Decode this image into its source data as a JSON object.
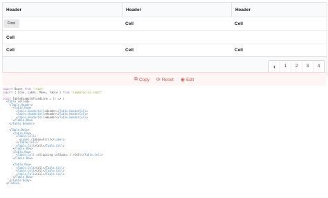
{
  "table": {
    "headers": [
      "Header",
      "Header",
      "Header"
    ],
    "ribbon_label": "First",
    "rows": [
      [
        "Cell",
        "Cell"
      ],
      [
        "Cell"
      ],
      [
        "Cell",
        "Cell",
        "Cell"
      ]
    ],
    "pagination": {
      "prev_icon": "chevron-left-icon",
      "pages": [
        "1",
        "2",
        "3",
        "4"
      ]
    }
  },
  "toolbar": {
    "copy_label": "Copy",
    "reset_label": "Reset",
    "edit_label": "Edit",
    "copy_icon": "copy-icon",
    "reset_icon": "refresh-icon",
    "edit_icon": "github-icon"
  },
  "code_lines": [
    "import React from 'react'",
    "import { Icon, Label, Menu, Table } from 'semantic-ui-react'",
    "",
    "const TableExampleFixedLine = () => (",
    "  <Table celled>",
    "    <Table.Header>",
    "      <Table.Row>",
    "        <Table.HeaderCell>Header</Table.HeaderCell>",
    "        <Table.HeaderCell>Header</Table.HeaderCell>",
    "        <Table.HeaderCell>Header</Table.HeaderCell>",
    "      </Table.Row>",
    "    </Table.Header>",
    "",
    "    <Table.Body>",
    "      <Table.Row>",
    "        <Table.Cell>",
    "          <Label ribbon>First</Label>",
    "        </Table.Cell>",
    "        <Table.Cell>Cell</Table.Cell>",
    "      </Table.Row>",
    "      <Table.Row>",
    "        <Table.Cell collapsing colSpan='3'>Cell</Table.Cell>",
    "      </Table.Row>",
    "",
    "      <Table.Row>",
    "        <Table.Cell>Cell</Table.Cell>",
    "        <Table.Cell>Cell</Table.Cell>",
    "        <Table.Cell>Cell</Table.Cell>",
    "      </Table.Row>",
    "    </Table.Body>",
    "  </Table>"
  ]
}
